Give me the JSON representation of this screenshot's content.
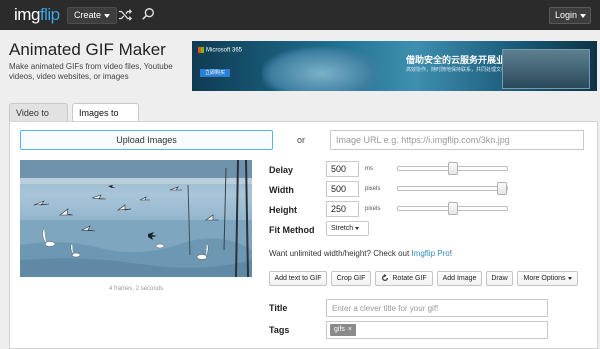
{
  "header": {
    "logo_part1": "img",
    "logo_part2": "flip",
    "create_label": "Create",
    "login_label": "Login",
    "shuffle_icon": "shuffle-icon",
    "search_icon": "search-icon"
  },
  "page": {
    "title": "Animated GIF Maker",
    "description": "Make animated GIFs from video files, Youtube videos, video websites, or images"
  },
  "ad": {
    "brand": "Microsoft 365",
    "cta": "立即购买",
    "headline": "借助安全的云服务开展业务",
    "sub": "高效协作，随时随地保持联系，共同处理文档"
  },
  "tabs": [
    {
      "label": "Video to GIF",
      "active": false
    },
    {
      "label": "Images to GIF",
      "active": true
    }
  ],
  "upload": {
    "button_label": "Upload Images",
    "or_label": "or",
    "url_placeholder": "Image URL e.g. https://i.imgflip.com/3kn.jpg"
  },
  "preview": {
    "caption": "4 frames, 2 seconds"
  },
  "settings": {
    "delay": {
      "label": "Delay",
      "value": "500",
      "unit": "ms",
      "slider_fraction": 0.5
    },
    "width": {
      "label": "Width",
      "value": "500",
      "unit": "pixels",
      "slider_fraction": 1.0
    },
    "height": {
      "label": "Height",
      "value": "250",
      "unit": "pixels",
      "slider_fraction": 0.5
    },
    "fit_method": {
      "label": "Fit Method",
      "selected": "Stretch"
    }
  },
  "promo": {
    "text": "Want unlimited width/height? Check out ",
    "link": "Imgflip Pro",
    "suffix": "!"
  },
  "tools": {
    "add_text": "Add text to GIF",
    "crop": "Crop GIF",
    "rotate": "Rotate GIF",
    "add_image": "Add Image",
    "draw": "Draw",
    "more_options": "More Options"
  },
  "meta": {
    "title_label": "Title",
    "title_placeholder": "Enter a clever title for your gif!",
    "tags_label": "Tags",
    "tags": [
      "gifs"
    ]
  },
  "colors": {
    "header_bg": "#2b2b2b",
    "accent": "#3aa3e3",
    "link": "#2b8ab8"
  }
}
